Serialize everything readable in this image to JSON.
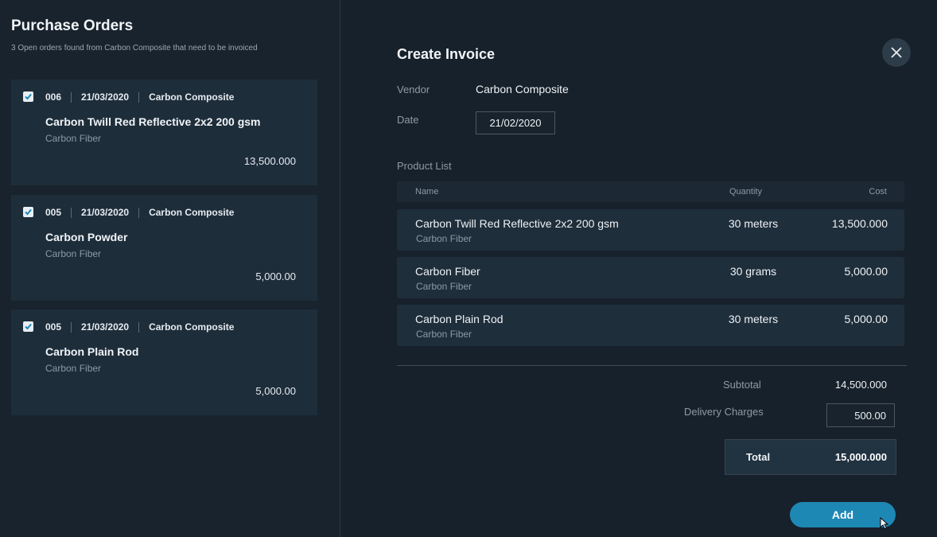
{
  "left": {
    "title": "Purchase Orders",
    "subtitle": "3 Open orders found from Carbon Composite that need to be invoiced",
    "orders": [
      {
        "id": "006",
        "date": "21/03/2020",
        "vendor": "Carbon Composite",
        "name": "Carbon Twill Red Reflective 2x2 200 gsm",
        "category": "Carbon Fiber",
        "amount": "13,500.000",
        "checked": true
      },
      {
        "id": "005",
        "date": "21/03/2020",
        "vendor": "Carbon Composite",
        "name": "Carbon Powder",
        "category": "Carbon Fiber",
        "amount": "5,000.00",
        "checked": true
      },
      {
        "id": "005",
        "date": "21/03/2020",
        "vendor": "Carbon Composite",
        "name": "Carbon Plain Rod",
        "category": "Carbon Fiber",
        "amount": "5,000.00",
        "checked": true
      }
    ]
  },
  "invoice": {
    "title": "Create Invoice",
    "vendor_label": "Vendor",
    "vendor_value": "Carbon Composite",
    "date_label": "Date",
    "date_value": "21/02/2020",
    "product_list_label": "Product List",
    "columns": {
      "name": "Name",
      "quantity": "Quantity",
      "cost": "Cost"
    },
    "products": [
      {
        "name": "Carbon Twill Red Reflective 2x2 200 gsm",
        "category": "Carbon Fiber",
        "quantity": "30 meters",
        "cost": "13,500.000"
      },
      {
        "name": "Carbon Fiber",
        "category": "Carbon Fiber",
        "quantity": "30  grams",
        "cost": "5,000.00"
      },
      {
        "name": "Carbon Plain Rod",
        "category": "Carbon Fiber",
        "quantity": "30  meters",
        "cost": "5,000.00"
      }
    ],
    "subtotal_label": "Subtotal",
    "subtotal_value": "14,500.000",
    "delivery_label": "Delivery Charges",
    "delivery_value": "500.00",
    "total_label": "Total",
    "total_value": "15,000.000",
    "add_label": "Add"
  },
  "colors": {
    "accent": "#1e88b5",
    "background": "#17212b",
    "card": "#1e2d3a"
  },
  "icons": {
    "close": "close-icon",
    "check": "checkbox-checked-icon",
    "cursor": "mouse-pointer-icon"
  }
}
